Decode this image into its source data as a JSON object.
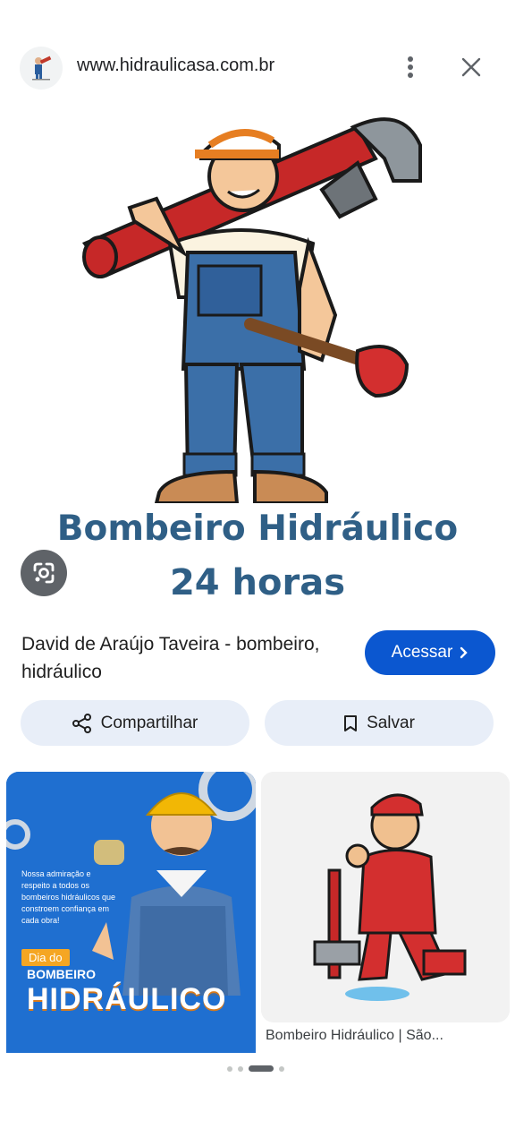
{
  "header": {
    "url": "www.hidraulicasa.com.br",
    "favicon_icon": "plumber-logo-icon",
    "menu_icon": "more-vert-icon",
    "close_icon": "close-icon"
  },
  "hero": {
    "title_line1": "Bombeiro Hidráulico",
    "title_line2": "24 horas",
    "title_color": "#2f5f86"
  },
  "lens_icon": "google-lens-icon",
  "caption": "David de Araújo Taveira - bombeiro, hidráulico",
  "visit_button": {
    "label": "Acessar",
    "icon": "chevron-right-icon",
    "color": "#0b57d0"
  },
  "actions": {
    "share_label": "Compartilhar",
    "share_icon": "share-icon",
    "save_label": "Salvar",
    "save_icon": "bookmark-icon"
  },
  "related": [
    {
      "small_text": "Nossa admiração e respeito a todos os bombeiros hidráulicos que constroem confiança em cada obra!",
      "tag": "Dia do",
      "bold1": "BOMBEIRO",
      "bold2": "HIDRÁULICO"
    },
    {
      "title": "Bombeiro Hidráulico | São..."
    }
  ],
  "pagination": {
    "count": 4,
    "active": 2
  }
}
